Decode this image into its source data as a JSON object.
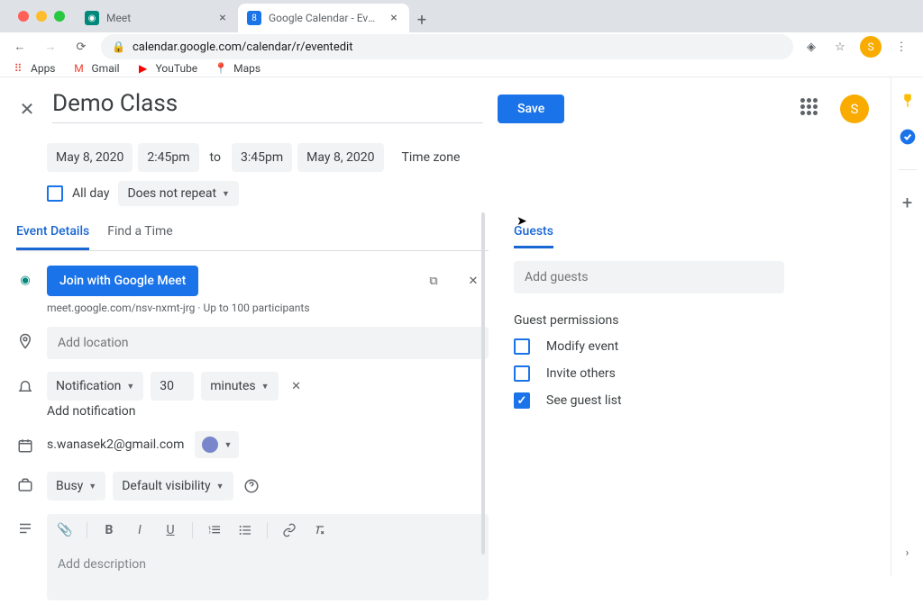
{
  "browser": {
    "tabs": [
      {
        "title": "Meet",
        "favicon_color": "#00897b"
      },
      {
        "title": "Google Calendar - Event detail",
        "favicon_color": "#1a73e8",
        "favicon_text": "8"
      }
    ],
    "url": "calendar.google.com/calendar/r/eventedit",
    "avatar_letter": "S",
    "bookmarks": {
      "apps": "Apps",
      "gmail": "Gmail",
      "youtube": "YouTube",
      "maps": "Maps"
    }
  },
  "event": {
    "title": "Demo Class",
    "save_label": "Save",
    "start_date": "May 8, 2020",
    "start_time": "2:45pm",
    "to": "to",
    "end_time": "3:45pm",
    "end_date": "May 8, 2020",
    "timezone_link": "Time zone",
    "all_day_label": "All day",
    "repeat_label": "Does not repeat",
    "tabs": {
      "details": "Event Details",
      "find_time": "Find a Time"
    },
    "meet_button": "Join with Google Meet",
    "meet_url": "meet.google.com/nsv-nxmt-jrg",
    "meet_capacity": "Up to 100 participants",
    "location_placeholder": "Add location",
    "notification": {
      "type": "Notification",
      "value": "30",
      "unit": "minutes"
    },
    "add_notification": "Add notification",
    "organizer_email": "s.wanasek2@gmail.com",
    "availability": "Busy",
    "visibility": "Default visibility",
    "description_placeholder": "Add description"
  },
  "guests": {
    "tab_label": "Guests",
    "add_placeholder": "Add guests",
    "permissions_title": "Guest permissions",
    "perms": {
      "modify": "Modify event",
      "invite": "Invite others",
      "see_list": "See guest list"
    }
  }
}
